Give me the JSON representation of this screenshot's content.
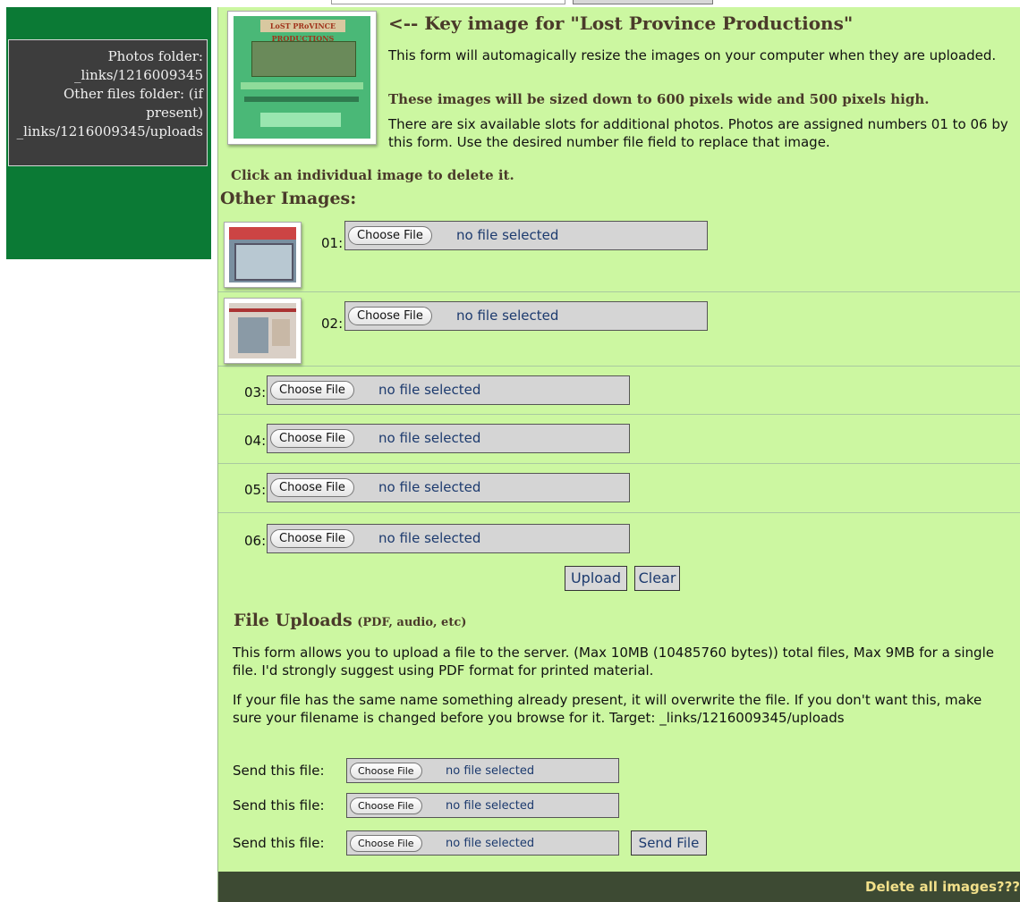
{
  "left_panel": {
    "photos_folder_label": "Photos folder:",
    "photos_folder_path": "_links/1216009345",
    "other_folder_label": "Other files folder: (if",
    "other_folder_label2": "present)",
    "other_folder_path": "_links/1216009345/uploads"
  },
  "header": {
    "key_heading": "<-- Key image for \"Lost Province Productions\"",
    "key_image_logo": "LoST PRoVINCE PRODUCTIONS",
    "intro_1": "This form will automagically resize the images on your computer when they are uploaded.",
    "intro_2": "These images will be sized down to 600 pixels wide and 500 pixels high.",
    "intro_3": "There are six available slots for additional photos. Photos are assigned numbers 01 to 06 by this form. Use the desired number file field to replace that image."
  },
  "images": {
    "click_note": "Click an individual image to delete it.",
    "other_heading": "Other Images:",
    "slots": [
      {
        "label": "01:",
        "button": "Choose File",
        "status": "no file selected"
      },
      {
        "label": "02:",
        "button": "Choose File",
        "status": "no file selected"
      },
      {
        "label": "03:",
        "button": "Choose File",
        "status": "no file selected"
      },
      {
        "label": "04:",
        "button": "Choose File",
        "status": "no file selected"
      },
      {
        "label": "05:",
        "button": "Choose File",
        "status": "no file selected"
      },
      {
        "label": "06:",
        "button": "Choose File",
        "status": "no file selected"
      }
    ],
    "upload_label": "Upload",
    "clear_label": "Clear"
  },
  "file_uploads": {
    "heading": "File Uploads",
    "heading_small": "(PDF, audio, etc)",
    "p1": "This form allows you to upload a file to the server. (Max 10MB (10485760 bytes)) total files, Max 9MB for a single file. I'd strongly suggest using PDF format for printed material.",
    "p2": "If your file has the same name something already present, it will overwrite the file. If you don't want this, make sure your filename is changed before you browse for it. Target: _links/1216009345/uploads",
    "rows": [
      {
        "label": "Send this file:",
        "button": "Choose File",
        "status": "no file selected"
      },
      {
        "label": "Send this file:",
        "button": "Choose File",
        "status": "no file selected"
      },
      {
        "label": "Send this file:",
        "button": "Choose File",
        "status": "no file selected"
      }
    ],
    "send_label": "Send File"
  },
  "footer": {
    "delete_all": "Delete all images???"
  }
}
